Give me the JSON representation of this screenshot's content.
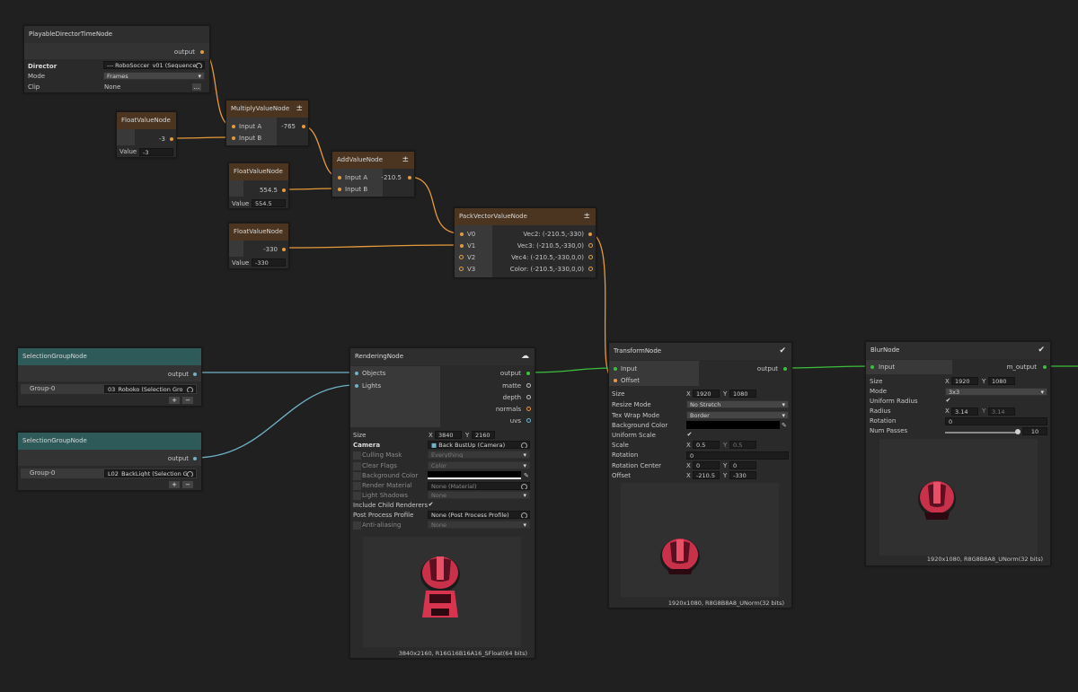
{
  "colors": {
    "background": "#202020",
    "orange_wire": "#e79a3a",
    "green_wire": "#3cbf3c",
    "blue_wire": "#6fb3c8",
    "header_brown": "#4b3520",
    "header_teal": "#2f5a5a",
    "robot_red": "#d8334f"
  },
  "director_node": {
    "title": "PlayableDirectorTimeNode",
    "output_label": "output",
    "director_label": "Director",
    "director_value": "--- RoboSoccer_v01 (Sequence",
    "mode_label": "Mode",
    "mode_value": "Frames",
    "clip_label": "Clip",
    "clip_value": "None",
    "clip_button": "..."
  },
  "float_nodes": [
    {
      "title": "FloatValueNode",
      "output": "-3",
      "value_label": "Value",
      "value": "-3"
    },
    {
      "title": "FloatValueNode",
      "output": "554.5",
      "value_label": "Value",
      "value": "554.5"
    },
    {
      "title": "FloatValueNode",
      "output": "-330",
      "value_label": "Value",
      "value": "-330"
    }
  ],
  "multiply_node": {
    "title": "MultiplyValueNode",
    "input_a": "Input A",
    "input_b": "Input B",
    "output": "-765",
    "icon": "plus-minus-icon"
  },
  "add_node": {
    "title": "AddValueNode",
    "input_a": "Input A",
    "input_b": "Input B",
    "output": "-210.5",
    "icon": "plus-minus-icon"
  },
  "pack_node": {
    "title": "PackVectorValueNode",
    "inputs": [
      "V0",
      "V1",
      "V2",
      "V3"
    ],
    "outputs": [
      "Vec2: (-210.5,-330)",
      "Vec3: (-210.5,-330,0)",
      "Vec4: (-210.5,-330,0,0)",
      "Color: (-210.5,-330,0,0)"
    ]
  },
  "selection_nodes": [
    {
      "title": "SelectionGroupNode",
      "output": "output",
      "group_label": "Group-0",
      "group_value": "03_Roboko (Selection Gro",
      "add": "+",
      "remove": "−"
    },
    {
      "title": "SelectionGroupNode",
      "output": "output",
      "group_label": "Group-0",
      "group_value": "L02_BackLight (Selection G",
      "add": "+",
      "remove": "−"
    }
  ],
  "rendering_node": {
    "title": "RenderingNode",
    "inputs": [
      "Objects",
      "Lights"
    ],
    "outputs": [
      "output",
      "matte",
      "depth",
      "normals",
      "uvs"
    ],
    "size_label": "Size",
    "size_x_label": "X",
    "size_x": "3840",
    "size_y_label": "Y",
    "size_y": "2160",
    "camera_label": "Camera",
    "camera_value": "Back BustUp (Camera)",
    "culling_label": "Culling Mask",
    "culling_value": "Everything",
    "clear_label": "Clear Flags",
    "clear_value": "Color",
    "bg_label": "Background Color",
    "render_mat_label": "Render Material",
    "render_mat_value": "None (Material)",
    "light_shadows_label": "Light Shadows",
    "light_shadows_value": "None",
    "include_child_label": "Include Child Renderers",
    "post_label": "Post Process Profile",
    "post_value": "None (Post Process Profile)",
    "aa_label": "Anti-aliasing",
    "aa_value": "None",
    "resolution": "3840x2160, R16G16B16A16_SFloat(64 bits)"
  },
  "transform_node": {
    "title": "TransformNode",
    "inputs": [
      "Input",
      "Offset"
    ],
    "output": "output",
    "size_label": "Size",
    "size_x": "1920",
    "size_y": "1080",
    "resize_label": "Resize Mode",
    "resize_value": "No Stretch",
    "tex_wrap_label": "Tex Wrap Mode",
    "tex_wrap_value": "Border",
    "bg_label": "Background Color",
    "uniform_label": "Uniform Scale",
    "scale_label": "Scale",
    "scale_x": "0.5",
    "scale_y": "0.5",
    "rotation_label": "Rotation",
    "rotation_value": "0",
    "rot_center_label": "Rotation Center",
    "rot_center_x": "0",
    "rot_center_y": "0",
    "offset_label": "Offset",
    "offset_x": "-210.5",
    "offset_y": "-330",
    "x_label": "X",
    "y_label": "Y",
    "resolution": "1920x1080, R8G8B8A8_UNorm(32 bits)"
  },
  "blur_node": {
    "title": "BlurNode",
    "input": "Input",
    "output": "m_output",
    "size_label": "Size",
    "size_x": "1920",
    "size_y": "1080",
    "mode_label": "Mode",
    "mode_value": "3x3",
    "uniform_label": "Uniform Radius",
    "radius_label": "Radius",
    "radius_x": "3.14",
    "radius_y": "3.14",
    "rotation_label": "Rotation",
    "rotation_value": "0",
    "passes_label": "Num Passes",
    "passes_value": "10",
    "x_label": "X",
    "y_label": "Y",
    "resolution": "1920x1080, R8G8B8A8_UNorm(32 bits)"
  }
}
